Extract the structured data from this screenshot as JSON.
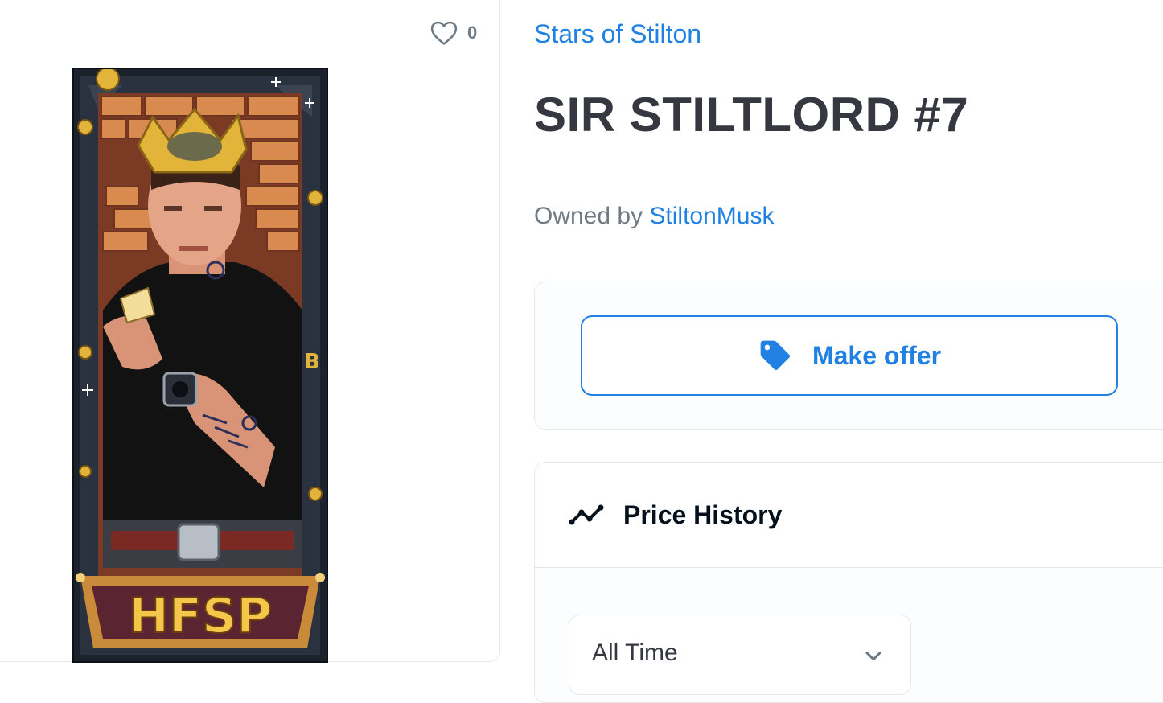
{
  "favorite": {
    "count": "0",
    "icon": "heart-icon"
  },
  "artwork": {
    "banner_text": "HFSP",
    "coin_letter": "B"
  },
  "collection": {
    "name": "Stars of Stilton"
  },
  "item": {
    "title": "SIR STILTLORD #7"
  },
  "owner": {
    "prefix": "Owned by",
    "name": "StiltonMusk"
  },
  "offer": {
    "label": "Make offer",
    "icon": "tag-icon"
  },
  "price_history": {
    "title": "Price History",
    "icon": "trend-line-icon"
  },
  "range_select": {
    "value": "All Time",
    "icon": "chevron-down-icon"
  },
  "colors": {
    "accent": "#2081e2",
    "text": "#353840",
    "muted": "#707a83",
    "border": "#e5e8eb"
  }
}
